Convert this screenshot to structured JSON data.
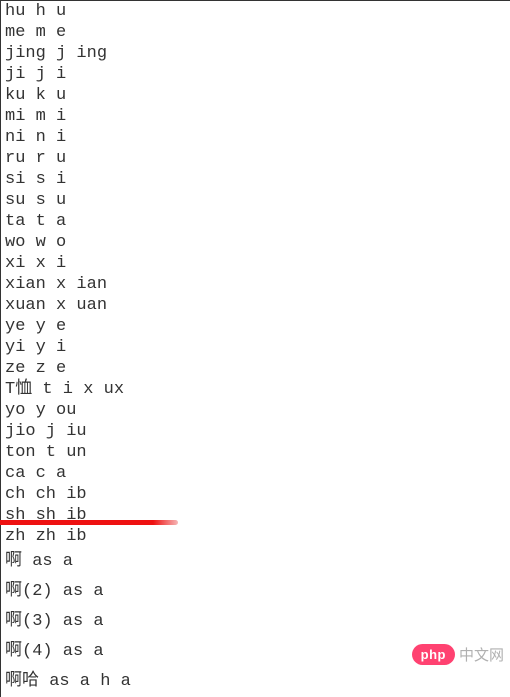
{
  "lines_top": [
    "hu h u",
    "me m e",
    "jing j ing",
    "ji j i",
    "ku k u",
    "mi m i",
    "ni n i",
    "ru r u",
    "si s i",
    "su s u",
    "ta t a",
    "wo w o",
    "xi x i",
    "xian x ian",
    "xuan x uan",
    "ye y e",
    "yi y i",
    "ze z e",
    "T恤 t i x ux",
    "yo y ou",
    "jio j iu",
    "ton t un",
    "ca c a",
    "ch ch ib",
    "sh sh ib",
    "zh zh ib"
  ],
  "lines_wide": [
    "啊 as a",
    "啊(2) as a",
    "啊(3) as a",
    "啊(4) as a",
    "啊哈 as a h a"
  ],
  "badge": {
    "pill": "php",
    "text": "中文网"
  }
}
